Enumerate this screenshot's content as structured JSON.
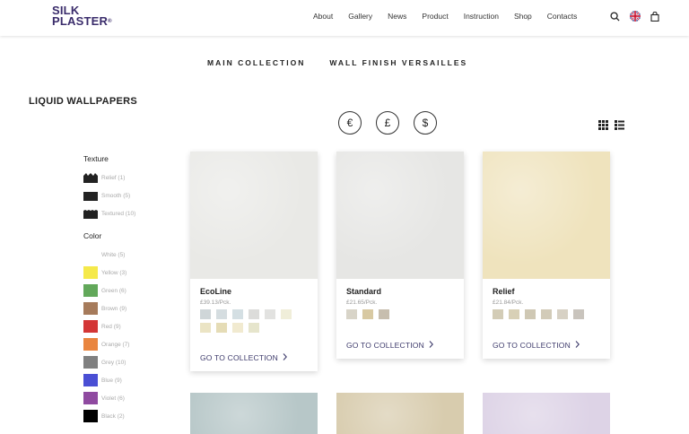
{
  "header": {
    "logo_line1": "SILK",
    "logo_line2": "PLASTER",
    "logo_mark": "®",
    "nav": [
      "About",
      "Gallery",
      "News",
      "Product",
      "Instruction",
      "Shop",
      "Contacts"
    ],
    "icons": [
      "search-icon",
      "uk-flag-icon",
      "shopping-bag-icon"
    ]
  },
  "tabs": [
    "MAIN COLLECTION",
    "WALL FINISH VERSAILLES"
  ],
  "page_title": "LIQUID WALLPAPERS",
  "currency": [
    "€",
    "£",
    "$"
  ],
  "view_toggle": [
    "grid-view-icon",
    "list-view-icon"
  ],
  "filters": {
    "texture_title": "Texture",
    "textures": [
      {
        "label": "Relief (1)",
        "icon": "relief-texture-icon"
      },
      {
        "label": "Smooth (5)",
        "icon": "smooth-texture-icon"
      },
      {
        "label": "Textured (10)",
        "icon": "textured-texture-icon"
      }
    ],
    "color_title": "Color",
    "colors": [
      {
        "label": "White (5)",
        "color": "#ffffff"
      },
      {
        "label": "Yellow (3)",
        "color": "#f5e94a"
      },
      {
        "label": "Green (6)",
        "color": "#62a85a"
      },
      {
        "label": "Brown (9)",
        "color": "#a67b5b"
      },
      {
        "label": "Red (9)",
        "color": "#d33636"
      },
      {
        "label": "Orange (7)",
        "color": "#e9853f"
      },
      {
        "label": "Grey (10)",
        "color": "#808080"
      },
      {
        "label": "Blue (9)",
        "color": "#4a4fd4"
      },
      {
        "label": "Violet (6)",
        "color": "#8f4aa0"
      },
      {
        "label": "Black (2)",
        "color": "#000000"
      }
    ]
  },
  "products": [
    {
      "name": "EcoLine",
      "price": "£39.13/Pck.",
      "link": "GO TO COLLECTION",
      "image_color": "#e9e9e6",
      "swatches": [
        "#cfd6d8",
        "#d5dde0",
        "#d4dfe3",
        "#dcdcda",
        "#e2e2e0",
        "#f0eed9",
        "#ebe4c4",
        "#e5dcb6",
        "#f1ead0",
        "#e6e5cc"
      ]
    },
    {
      "name": "Standard",
      "price": "£21.65/Pck.",
      "link": "GO TO COLLECTION",
      "image_color": "#e6e6e4",
      "swatches": [
        "#d8d4c8",
        "#d8c9a2",
        "#c7beae"
      ]
    },
    {
      "name": "Relief",
      "price": "£21.84/Pck.",
      "link": "GO TO COLLECTION",
      "image_color": "#efe3bd",
      "swatches": [
        "#d3ccb6",
        "#d8d0b6",
        "#cfc8b4",
        "#d2cbb8",
        "#d7d1c4",
        "#c9c4bd"
      ]
    }
  ],
  "more_products_colors": [
    "#b7c7c8",
    "#d8ccae",
    "#ddd3e6"
  ]
}
